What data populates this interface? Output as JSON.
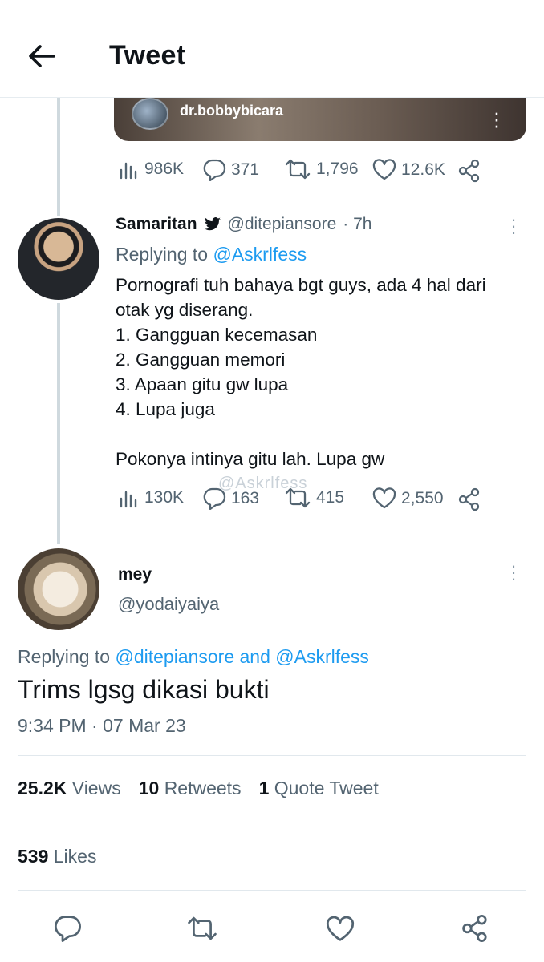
{
  "header": {
    "title": "Tweet"
  },
  "media": {
    "username": "dr.bobbybicara"
  },
  "quoted_actions": {
    "views": "986K",
    "replies": "371",
    "retweets": "1,796",
    "likes": "12.6K"
  },
  "tweet1": {
    "name": "Samaritan",
    "handle": "@ditepiansore",
    "time": "· 7h",
    "replying_prefix": "Replying to",
    "replying_to": "@Askrlfess",
    "body": "Pornografi tuh bahaya bgt guys, ada 4 hal dari otak yg diserang.\n1. Gangguan kecemasan\n2. Gangguan memori\n3. Apaan gitu gw lupa\n4. Lupa juga\n\nPokonya intinya gitu lah. Lupa gw",
    "watermark": "@Askrlfess",
    "views": "130K",
    "replies": "163",
    "retweets": "415",
    "likes": "2,550"
  },
  "tweet2": {
    "name": "mey",
    "handle": "@yodaiyaiya",
    "replying_prefix": "Replying to",
    "replying_to": "@ditepiansore and @Askrlfess",
    "text": "Trims lgsg dikasi bukti",
    "timestamp": "9:34 PM · 07 Mar 23"
  },
  "stats": {
    "views_count": "25.2K",
    "views_label": "Views",
    "retweets_count": "10",
    "retweets_label": "Retweets",
    "quotes_count": "1",
    "quotes_label": "Quote Tweet",
    "likes_count": "539",
    "likes_label": "Likes"
  },
  "colors": {
    "accent": "#1d9bf0",
    "muted": "#536471",
    "text": "#0f1419"
  }
}
